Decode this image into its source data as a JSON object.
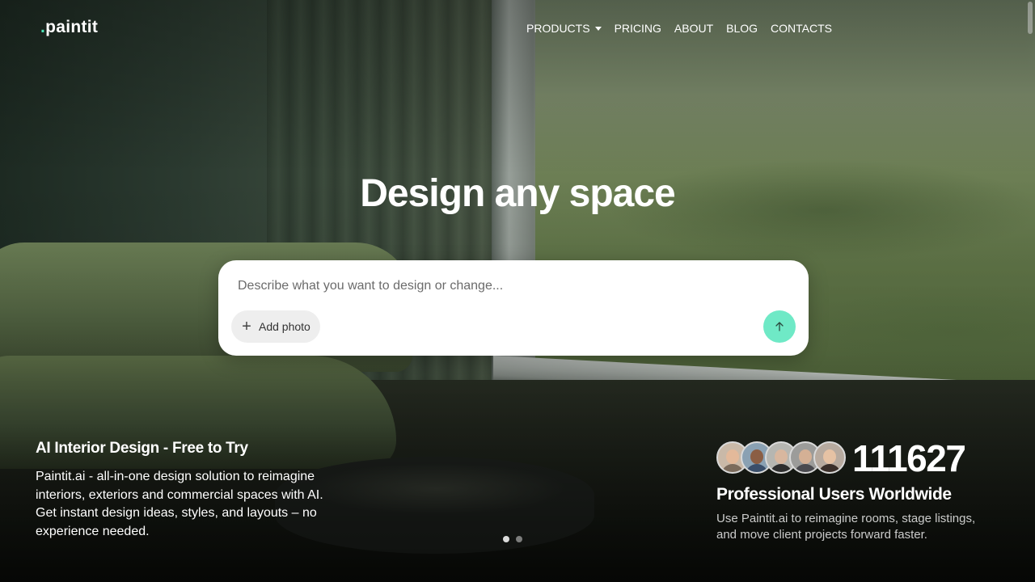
{
  "brand": {
    "dot": ".",
    "name": "paintit",
    "accent": "#4ee5b8"
  },
  "nav": {
    "items": [
      {
        "label": "PRODUCTS",
        "has_dropdown": true
      },
      {
        "label": "PRICING"
      },
      {
        "label": "ABOUT"
      },
      {
        "label": "BLOG"
      },
      {
        "label": "CONTACTS"
      }
    ]
  },
  "hero": {
    "title": "Design any space",
    "prompt_placeholder": "Describe what you want to design or change...",
    "add_photo_label": "Add photo",
    "send_icon": "arrow-up-icon",
    "send_color": "#6fe9c6"
  },
  "intro": {
    "title": "AI Interior Design - Free to Try",
    "text": "Paintit.ai - all-in-one design solution to reimagine interiors, exteriors and commercial spaces with AI. Get instant design ideas, styles, and layouts – no experience needed."
  },
  "carousel": {
    "slides": 2,
    "active_index": 0
  },
  "stats": {
    "count": "111627",
    "title": "Professional Users Worldwide",
    "text": "Use Paintit.ai to reimagine rooms, stage listings, and move client projects forward faster.",
    "avatar_count": 5
  }
}
